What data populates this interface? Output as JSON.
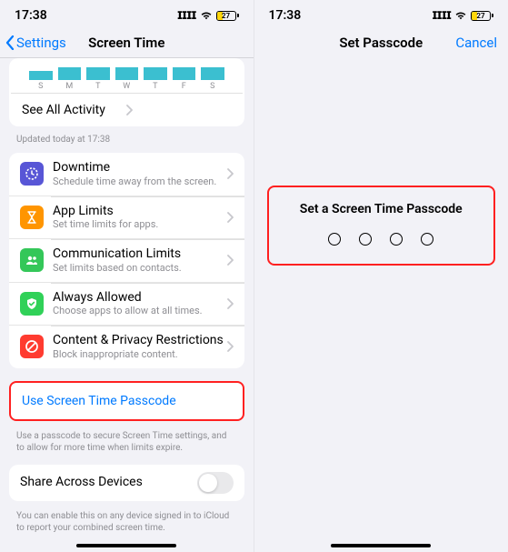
{
  "left": {
    "status": {
      "time": "17:38",
      "battery": "27"
    },
    "nav": {
      "back": "Settings",
      "title": "Screen Time"
    },
    "chart": {
      "days": [
        "S",
        "M",
        "T",
        "W",
        "T",
        "F",
        "S"
      ]
    },
    "see_all": "See All Activity",
    "updated": "Updated today at 17:38",
    "rows": {
      "downtime": {
        "title": "Downtime",
        "sub": "Schedule time away from the screen."
      },
      "app_limits": {
        "title": "App Limits",
        "sub": "Set time limits for apps."
      },
      "comm_limits": {
        "title": "Communication Limits",
        "sub": "Set limits based on contacts."
      },
      "always": {
        "title": "Always Allowed",
        "sub": "Choose apps to allow at all times."
      },
      "content": {
        "title": "Content & Privacy Restrictions",
        "sub": "Block inappropriate content."
      }
    },
    "passcode": {
      "link": "Use Screen Time Passcode",
      "note": "Use a passcode to secure Screen Time settings, and to allow for more time when limits expire."
    },
    "share": {
      "title": "Share Across Devices",
      "note": "You can enable this on any device signed in to iCloud to report your combined screen time."
    }
  },
  "right": {
    "status": {
      "time": "17:38",
      "battery": "27"
    },
    "nav": {
      "title": "Set Passcode",
      "cancel": "Cancel"
    },
    "prompt": "Set a Screen Time Passcode"
  }
}
